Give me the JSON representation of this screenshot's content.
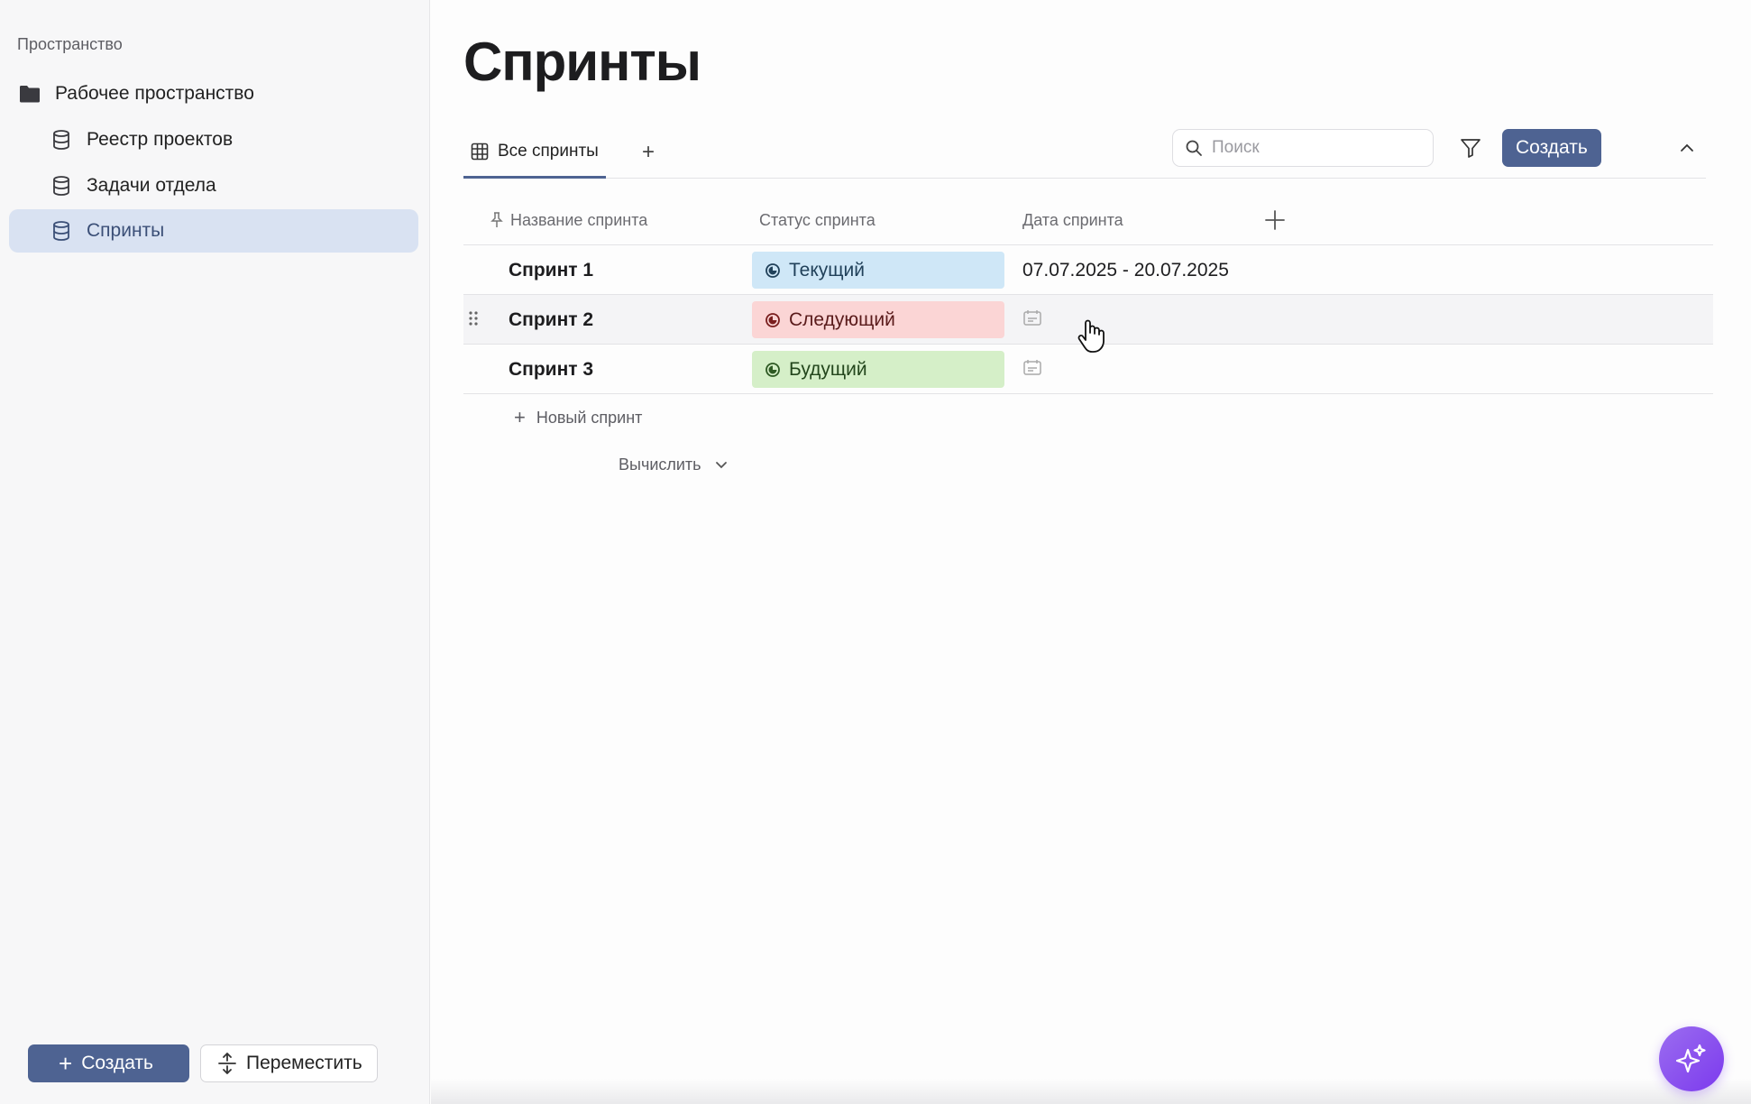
{
  "sidebar": {
    "section_title": "Пространство",
    "workspace": {
      "label": "Рабочее пространство",
      "icon": "folder-icon"
    },
    "items": [
      {
        "label": "Реестр проектов",
        "icon": "database-icon",
        "active": false
      },
      {
        "label": "Задачи отдела",
        "icon": "database-icon",
        "active": false
      },
      {
        "label": "Спринты",
        "icon": "database-icon",
        "active": true
      }
    ],
    "create_label": "Создать",
    "move_label": "Переместить"
  },
  "page": {
    "title": "Спринты"
  },
  "toolbar": {
    "tab_label": "Все спринты",
    "search_placeholder": "Поиск",
    "create_label": "Создать"
  },
  "table": {
    "columns": [
      "Название спринта",
      "Статус спринта",
      "Дата спринта"
    ],
    "rows": [
      {
        "name": "Спринт 1",
        "status": "Текущий",
        "status_color": "#cfe7f7",
        "status_text_color": "#21415a",
        "date": "07.07.2025 - 20.07.2025"
      },
      {
        "name": "Спринт 2",
        "status": "Следующий",
        "status_color": "#fbd5d5",
        "status_text_color": "#5a1b1b",
        "date": ""
      },
      {
        "name": "Спринт 3",
        "status": "Будущий",
        "status_color": "#d5efc8",
        "status_text_color": "#23461c",
        "date": ""
      }
    ],
    "new_row_label": "Новый спринт",
    "calc_label": "Вычислить"
  },
  "colors": {
    "accent": "#4e6392",
    "active_sidebar": "#d9e2f2",
    "ai_button": "#8b5cf6"
  }
}
